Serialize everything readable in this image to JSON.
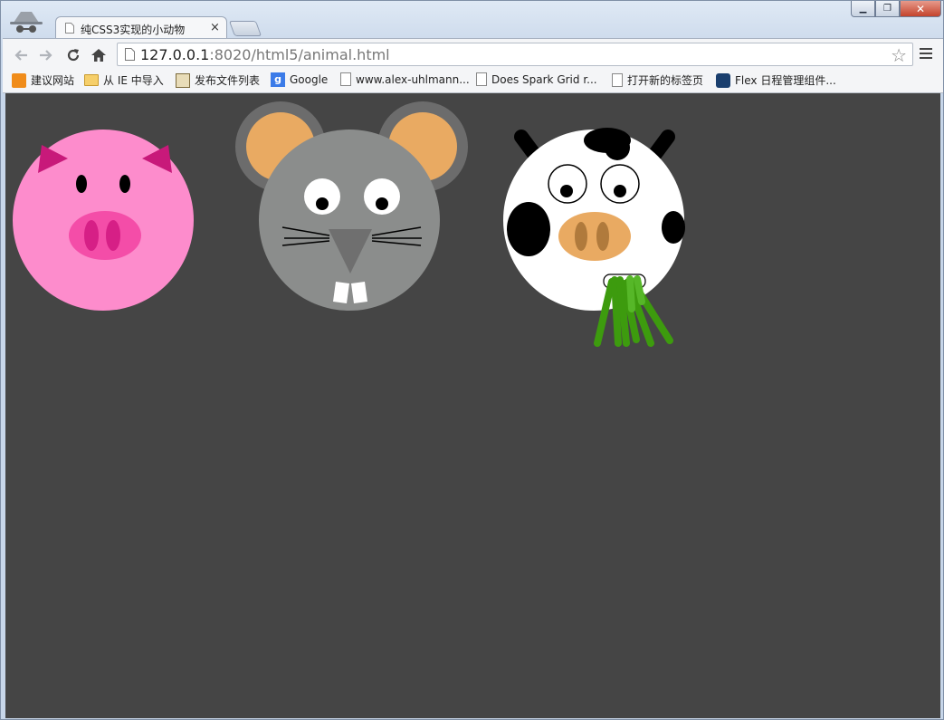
{
  "browser": {
    "tab_title": "纯CSS3实现的小动物",
    "tab_close": "×",
    "url_host": "127.0.0.1",
    "url_rest": ":8020/html5/animal.html",
    "star_glyph": "☆"
  },
  "bookmarks": [
    {
      "label": "建议网站",
      "icon": "suggested-sites-icon"
    },
    {
      "label": "从 IE 中导入",
      "icon": "folder-icon"
    },
    {
      "label": "发布文件列表",
      "icon": "publish-icon"
    },
    {
      "label": "Google",
      "icon": "google-icon"
    },
    {
      "label": "www.alex-uhlmann...",
      "icon": "page-icon"
    },
    {
      "label": "Does Spark Grid r...",
      "icon": "page-icon"
    },
    {
      "label": "打开新的标签页",
      "icon": "page-icon"
    },
    {
      "label": "Flex 日程管理组件...",
      "icon": "flex-icon"
    }
  ],
  "colors": {
    "background": "#454545",
    "pig": "#fd8ccc",
    "pig_ear": "#c8197a",
    "pig_nose": "#f44da8",
    "mouse": "#8b8d8c",
    "mouse_ear_outer": "#6c6c6c",
    "mouse_ear_inner": "#e9aa62",
    "cow": "#ffffff",
    "cow_nose": "#e9aa62",
    "grass": "#3d9b0e"
  },
  "animals": [
    "pig",
    "mouse",
    "cow"
  ]
}
